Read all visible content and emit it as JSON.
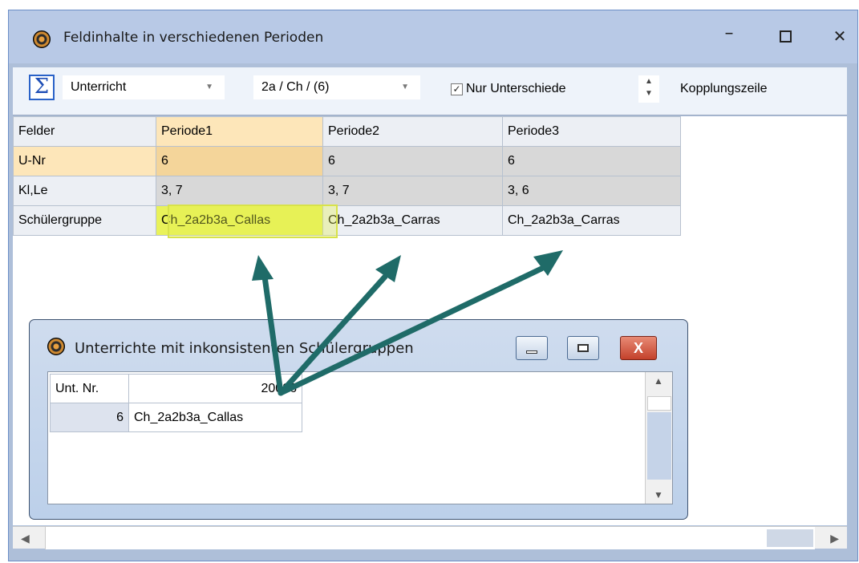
{
  "window": {
    "title": "Feldinhalte in verschiedenen Perioden",
    "minimize_glyph": "–",
    "close_glyph": "✕"
  },
  "toolbar": {
    "sigma_glyph": "Σ",
    "combo1_value": "Unterricht",
    "combo2_value": "2a / Ch / (6)",
    "dropdown_glyph": "▼",
    "nur_unterschiede_label": "Nur Unterschiede",
    "nur_unterschiede_checked": true,
    "check_glyph": "✓",
    "spinner_glyph": "▲\n▼",
    "kopplungszeile_label": "Kopplungszeile"
  },
  "grid": {
    "headers": [
      "Felder",
      "Periode1",
      "Periode2",
      "Periode3"
    ],
    "rows": [
      [
        "U-Nr",
        "6",
        "6",
        "6"
      ],
      [
        "Kl,Le",
        "3, 7",
        "3, 7",
        "3, 6"
      ],
      [
        "Schülergruppe",
        "Ch_2a2b3a_Callas",
        "Ch_2a2b3a_Carras",
        "Ch_2a2b3a_Carras"
      ]
    ],
    "selected_column": "Periode1",
    "highlighted_cell": "Ch_2a2b3a_Callas"
  },
  "hscroll": {
    "left_glyph": "◀",
    "right_glyph": "▶"
  },
  "dialog": {
    "title": "Unterrichte mit inkonsistenten Schülergruppen",
    "close_glyph": "X",
    "headers": [
      "Unt. Nr.",
      "20026"
    ],
    "rows": [
      [
        "6",
        "Ch_2a2b3a_Callas"
      ]
    ],
    "vscroll_up_glyph": "▲",
    "vscroll_down_glyph": "▼"
  },
  "colors": {
    "titlebar": "#b8c9e6",
    "selected_column": "#fde6b9",
    "highlight": "#e9f25a",
    "annotation_arrow": "#1f6b68"
  }
}
